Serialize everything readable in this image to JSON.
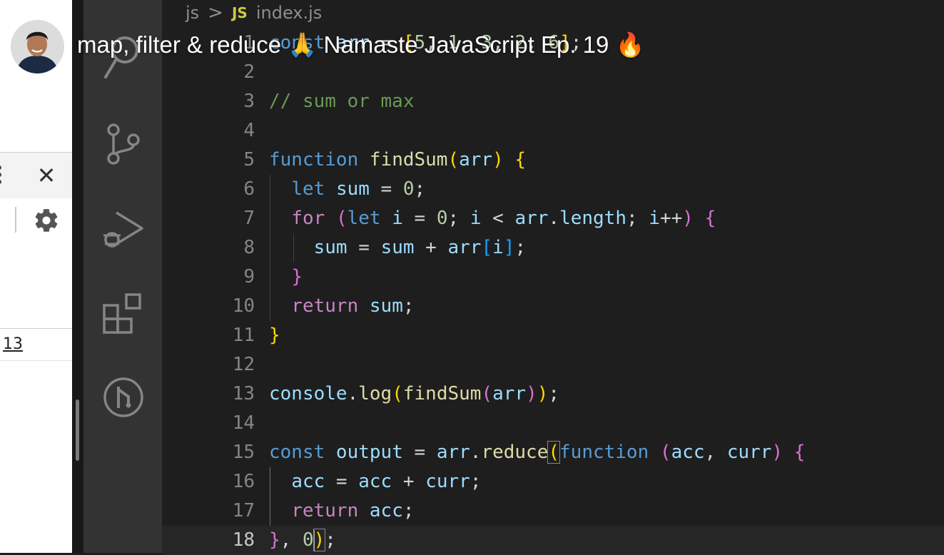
{
  "overlay": {
    "title": "map, filter & reduce 🙏 Namaste JavaScript Ep. 19 🔥"
  },
  "left_panel": {
    "console_value": "13",
    "icons": [
      "kebab-menu-icon",
      "close-icon",
      "gear-icon"
    ]
  },
  "activity_bar": {
    "icons": [
      "search-icon",
      "source-control-icon",
      "run-debug-icon",
      "extensions-icon",
      "git-graph-icon"
    ]
  },
  "breadcrumb": {
    "folder": "js",
    "separator": ">",
    "file_badge": "JS",
    "file": "index.js"
  },
  "editor": {
    "current_line": 18,
    "lines": [
      {
        "n": "1",
        "tokens": [
          {
            "t": "const ",
            "c": "kw"
          },
          {
            "t": "arr",
            "c": "var"
          },
          {
            "t": " = ",
            "c": ""
          },
          {
            "t": "[",
            "c": "p1"
          },
          {
            "t": "5",
            "c": "num"
          },
          {
            "t": ", ",
            "c": ""
          },
          {
            "t": "1",
            "c": "num"
          },
          {
            "t": ", ",
            "c": ""
          },
          {
            "t": "3",
            "c": "num"
          },
          {
            "t": ", ",
            "c": ""
          },
          {
            "t": "2",
            "c": "num"
          },
          {
            "t": ", ",
            "c": ""
          },
          {
            "t": "6",
            "c": "num"
          },
          {
            "t": "]",
            "c": "p1"
          },
          {
            "t": ";",
            "c": ""
          }
        ]
      },
      {
        "n": "2",
        "tokens": []
      },
      {
        "n": "3",
        "tokens": [
          {
            "t": "// sum or max",
            "c": "com"
          }
        ]
      },
      {
        "n": "4",
        "tokens": []
      },
      {
        "n": "5",
        "tokens": [
          {
            "t": "function ",
            "c": "kw"
          },
          {
            "t": "findSum",
            "c": "fn"
          },
          {
            "t": "(",
            "c": "p1"
          },
          {
            "t": "arr",
            "c": "var"
          },
          {
            "t": ")",
            "c": "p1"
          },
          {
            "t": " ",
            "c": ""
          },
          {
            "t": "{",
            "c": "p1"
          }
        ]
      },
      {
        "n": "6",
        "tokens": [
          {
            "t": "  ",
            "c": ""
          },
          {
            "t": "let ",
            "c": "kw"
          },
          {
            "t": "sum",
            "c": "var"
          },
          {
            "t": " = ",
            "c": ""
          },
          {
            "t": "0",
            "c": "num"
          },
          {
            "t": ";",
            "c": ""
          }
        ]
      },
      {
        "n": "7",
        "tokens": [
          {
            "t": "  ",
            "c": ""
          },
          {
            "t": "for ",
            "c": "ctl"
          },
          {
            "t": "(",
            "c": "p2"
          },
          {
            "t": "let ",
            "c": "kw"
          },
          {
            "t": "i",
            "c": "var"
          },
          {
            "t": " = ",
            "c": ""
          },
          {
            "t": "0",
            "c": "num"
          },
          {
            "t": "; ",
            "c": ""
          },
          {
            "t": "i",
            "c": "var"
          },
          {
            "t": " < ",
            "c": ""
          },
          {
            "t": "arr",
            "c": "var"
          },
          {
            "t": ".",
            "c": ""
          },
          {
            "t": "length",
            "c": "var"
          },
          {
            "t": "; ",
            "c": ""
          },
          {
            "t": "i",
            "c": "var"
          },
          {
            "t": "++",
            "c": ""
          },
          {
            "t": ")",
            "c": "p2"
          },
          {
            "t": " ",
            "c": ""
          },
          {
            "t": "{",
            "c": "p2"
          }
        ]
      },
      {
        "n": "8",
        "tokens": [
          {
            "t": "    ",
            "c": ""
          },
          {
            "t": "sum",
            "c": "var"
          },
          {
            "t": " = ",
            "c": ""
          },
          {
            "t": "sum",
            "c": "var"
          },
          {
            "t": " + ",
            "c": ""
          },
          {
            "t": "arr",
            "c": "var"
          },
          {
            "t": "[",
            "c": "p3"
          },
          {
            "t": "i",
            "c": "var"
          },
          {
            "t": "]",
            "c": "p3"
          },
          {
            "t": ";",
            "c": ""
          }
        ]
      },
      {
        "n": "9",
        "tokens": [
          {
            "t": "  ",
            "c": ""
          },
          {
            "t": "}",
            "c": "p2"
          }
        ]
      },
      {
        "n": "10",
        "tokens": [
          {
            "t": "  ",
            "c": ""
          },
          {
            "t": "return ",
            "c": "ctl"
          },
          {
            "t": "sum",
            "c": "var"
          },
          {
            "t": ";",
            "c": ""
          }
        ]
      },
      {
        "n": "11",
        "tokens": [
          {
            "t": "}",
            "c": "p1"
          }
        ]
      },
      {
        "n": "12",
        "tokens": []
      },
      {
        "n": "13",
        "tokens": [
          {
            "t": "console",
            "c": "var"
          },
          {
            "t": ".",
            "c": ""
          },
          {
            "t": "log",
            "c": "fn"
          },
          {
            "t": "(",
            "c": "p1"
          },
          {
            "t": "findSum",
            "c": "fn"
          },
          {
            "t": "(",
            "c": "p2"
          },
          {
            "t": "arr",
            "c": "var"
          },
          {
            "t": ")",
            "c": "p2"
          },
          {
            "t": ")",
            "c": "p1"
          },
          {
            "t": ";",
            "c": ""
          }
        ]
      },
      {
        "n": "14",
        "tokens": []
      },
      {
        "n": "15",
        "tokens": [
          {
            "t": "const ",
            "c": "kw"
          },
          {
            "t": "output",
            "c": "var"
          },
          {
            "t": " = ",
            "c": ""
          },
          {
            "t": "arr",
            "c": "var"
          },
          {
            "t": ".",
            "c": ""
          },
          {
            "t": "reduce",
            "c": "fn"
          },
          {
            "t": "(",
            "c": "p1 bracket-box"
          },
          {
            "t": "function ",
            "c": "kw"
          },
          {
            "t": "(",
            "c": "p2"
          },
          {
            "t": "acc",
            "c": "var"
          },
          {
            "t": ", ",
            "c": ""
          },
          {
            "t": "curr",
            "c": "var"
          },
          {
            "t": ")",
            "c": "p2"
          },
          {
            "t": " ",
            "c": ""
          },
          {
            "t": "{",
            "c": "p2"
          }
        ]
      },
      {
        "n": "16",
        "tokens": [
          {
            "t": "  ",
            "c": ""
          },
          {
            "t": "acc",
            "c": "var"
          },
          {
            "t": " = ",
            "c": ""
          },
          {
            "t": "acc",
            "c": "var"
          },
          {
            "t": " + ",
            "c": ""
          },
          {
            "t": "curr",
            "c": "var"
          },
          {
            "t": ";",
            "c": ""
          }
        ]
      },
      {
        "n": "17",
        "tokens": [
          {
            "t": "  ",
            "c": ""
          },
          {
            "t": "return ",
            "c": "ctl"
          },
          {
            "t": "acc",
            "c": "var"
          },
          {
            "t": ";",
            "c": ""
          }
        ]
      },
      {
        "n": "18",
        "tokens": [
          {
            "t": "}",
            "c": "p2"
          },
          {
            "t": ", ",
            "c": ""
          },
          {
            "t": "0",
            "c": "num"
          },
          {
            "t": "|",
            "c": "cursor"
          },
          {
            "t": ")",
            "c": "p1 bracket-box"
          },
          {
            "t": ";",
            "c": ""
          }
        ]
      }
    ]
  }
}
